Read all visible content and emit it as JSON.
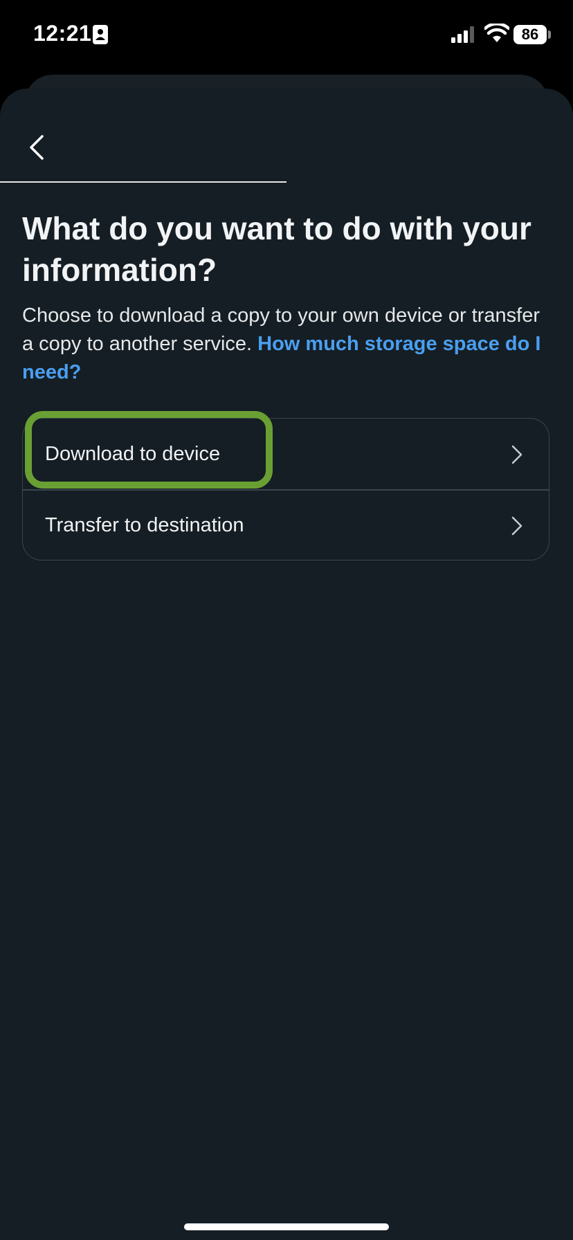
{
  "status_bar": {
    "time": "12:21",
    "battery_level": "86"
  },
  "header": {
    "progress_fraction": 0.5
  },
  "main": {
    "title": "What do you want to do with your information?",
    "description": "Choose to download a copy to your own device or transfer a copy to another service.",
    "help_link": "How much storage space do I need?",
    "options": [
      {
        "label": "Download to device"
      },
      {
        "label": "Transfer to destination"
      }
    ]
  },
  "colors": {
    "background": "#151e24",
    "link": "#4a9ff0",
    "highlight": "#6aa033",
    "border": "#3a4650"
  },
  "icons": {
    "back": "chevron-left-icon",
    "option_chevron": "chevron-right-icon",
    "wifi": "wifi-icon",
    "signal": "signal-icon",
    "contact": "contact-card-icon"
  }
}
